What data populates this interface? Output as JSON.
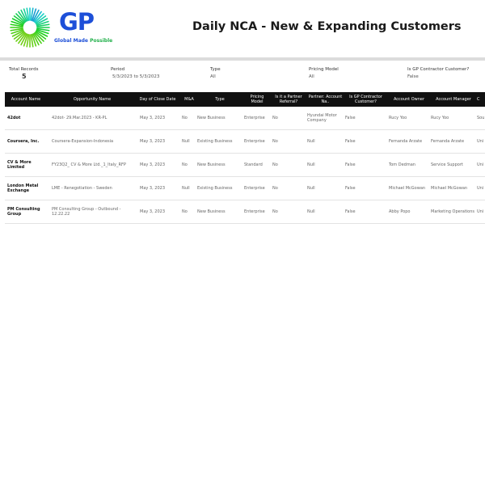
{
  "header": {
    "logo_letters": "GP",
    "logo_tagline_a": "Global Made ",
    "logo_tagline_b": "Possible",
    "title": "Daily NCA - New & Expanding Customers",
    "brand_color": "#1d4fd8",
    "accent_color": "#22b04b"
  },
  "filters": {
    "total_records": {
      "label": "Total Records",
      "value": "5"
    },
    "period": {
      "label": "Period",
      "value": "5/3/2023 to 5/3/2023"
    },
    "type": {
      "label": "Type",
      "value": "All"
    },
    "pricing_model": {
      "label": "Pricing Model",
      "value": "All"
    },
    "gp_contractor": {
      "label": "Is GP Contractor Customer?",
      "value": "False"
    }
  },
  "table": {
    "columns": [
      "Account Name",
      "Opportunity Name",
      "Day of Close Date",
      "M&A",
      "Type",
      "Pricing Model",
      "Is it a Partner Referral?",
      "Partner: Account Na..",
      "Is GP Contractor Customer?",
      "Account Owner",
      "Account Manager",
      "C"
    ],
    "rows": [
      [
        "42dot",
        "42dot- 29.Mar.2023 - KR-PL",
        "May 3, 2023",
        "No",
        "New Business",
        "Enterprise",
        "No",
        "Hyundai Motor Company",
        "False",
        "Rucy Yoo",
        "Rucy Yoo",
        "Sou"
      ],
      [
        "Coursera, Inc.",
        "Coursera-Expansion-Indonesia",
        "May 3, 2023",
        "Null",
        "Existing Business",
        "Enterprise",
        "No",
        "Null",
        "False",
        "Fernanda Arzate",
        "Fernanda Arzate",
        "Uni"
      ],
      [
        "CV & More Limited",
        "FY23Q2_ CV & More Ltd._1_Italy_RFP",
        "May 3, 2023",
        "No",
        "New Business",
        "Standard",
        "No",
        "Null",
        "False",
        "Tom Dedman",
        "Service Support",
        "Uni Kin"
      ],
      [
        "London Metal Exchange",
        "LME - Renegotiation - Sweden",
        "May 3, 2023",
        "Null",
        "Existing Business",
        "Enterprise",
        "No",
        "Null",
        "False",
        "Michael McGowan",
        "Michael McGowan",
        "Uni Kin"
      ],
      [
        "PM Consulting Group",
        "PM Consulting Group - Outbound - 12.22.22",
        "May 3, 2023",
        "No",
        "New Business",
        "Enterprise",
        "No",
        "Null",
        "False",
        "Abby Popo",
        "Marketing Operations",
        "Uni"
      ]
    ]
  }
}
